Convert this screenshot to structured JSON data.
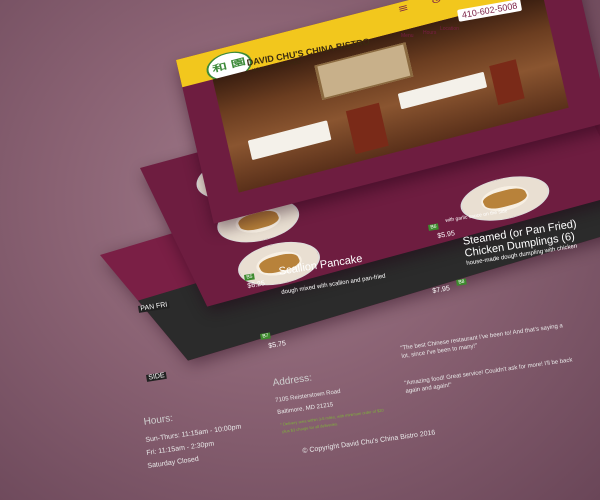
{
  "header": {
    "restaurant_name": "DAVID CHU'S CHINA BISTRO",
    "tagline": "KOSHER CERTIFIED",
    "logo_text": "和 園",
    "phone": "410-602-5008",
    "nav_items": [
      {
        "icon": "menu-icon",
        "label": "Menu"
      },
      {
        "icon": "hours-icon",
        "label": "Hours"
      },
      {
        "icon": "location-icon",
        "label": "Location"
      }
    ]
  },
  "menu": {
    "items": [
      {
        "name": "Scallion Pancake",
        "desc": "dough mixed with scallion and pan-fried",
        "price": "$6.25",
        "tag": "B5"
      },
      {
        "name": "Steamed (or Pan Fried) Chicken Dumplings (6)",
        "desc": "house-made dough dumpling with chicken",
        "price": "$7.95",
        "tag": "B8"
      },
      {
        "name": "",
        "desc": "",
        "price": "$5.75",
        "tag": "B7"
      },
      {
        "name": "",
        "desc": "with garlic sauce on the side",
        "price": "$5.95",
        "tag": "B6"
      }
    ],
    "side_labels": [
      "PAN FRI",
      "SIDE"
    ]
  },
  "footer": {
    "hours_title": "Hours:",
    "hours": [
      "Sun-Thurs: 11:15am - 10:00pm",
      "Fri: 11:15am - 2:30pm",
      "Saturday Closed"
    ],
    "address_title": "Address:",
    "address": [
      "7105 Reisterstown Road",
      "Baltimore, MD 21215"
    ],
    "delivery_note": [
      "* Delivery area within 3-5 miles, with minimum order of $20",
      "plus $3 charge for all deliveries."
    ],
    "testimonials": [
      "\"The best Chinese restaurant I've been to! And that's saying a lot, since I've been to many!\"",
      "\"Amazing food! Great service! Couldn't ask for more! I'll be back again and again!\""
    ],
    "copyright": "© Copyright David Chu's China Bistro 2016"
  },
  "colors": {
    "background": "#8a6273",
    "maroon": "#6e1d40",
    "header_yellow": "#f2c71d",
    "footer_dark": "#2b2b2b",
    "accent_green": "#3e8a2e"
  }
}
